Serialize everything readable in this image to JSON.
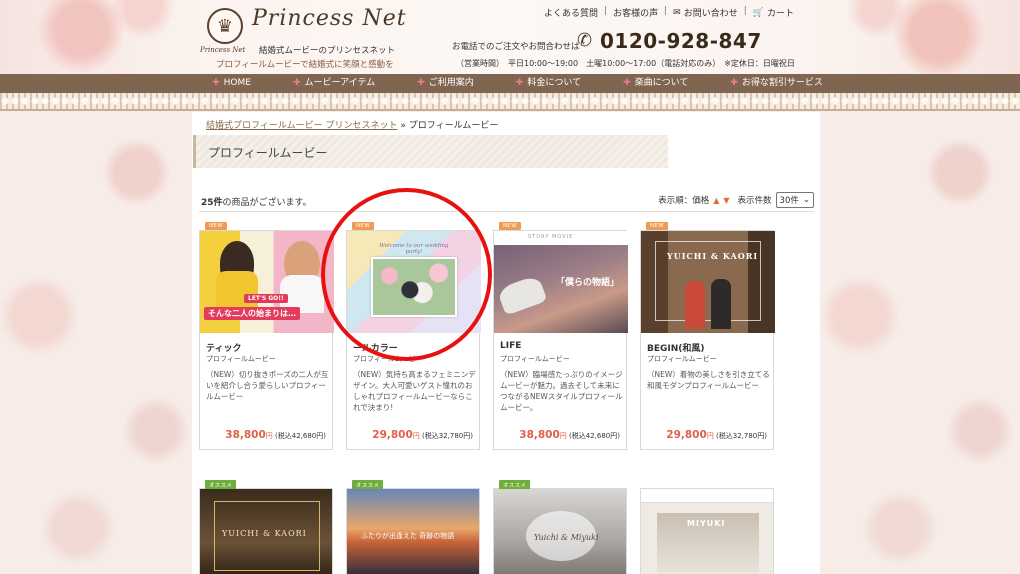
{
  "header": {
    "logo_script": "Princess Net",
    "logo_small": "Princess Net",
    "subtitle": "結婚式ムービーのプリンセスネット",
    "tagline": "プロフィールムービーで結婚式に笑顔と感動を",
    "top_links": [
      "よくある質問",
      "お客様の声",
      "お問い合わせ",
      "カート"
    ],
    "phone_lead": "お電話でのご注文やお問合わせは",
    "phone_number": "0120-928-847",
    "hours": "（営業時間）　平日10:00〜19:00　土曜10:00〜17:00（電話対応のみ）　※定休日：日曜祝日"
  },
  "nav": [
    "HOME",
    "ムービーアイテム",
    "ご利用案内",
    "料金について",
    "楽曲について",
    "お得な割引サービス"
  ],
  "breadcrumb": {
    "home": "結婚式プロフィールムービー プリンセスネット",
    "separator": "»",
    "current": "プロフィールムービー"
  },
  "page_title": "プロフィールムービー",
  "listing": {
    "count_number": "25件",
    "count_suffix": "の商品がございます。",
    "sort_label": "表示順：価格",
    "per_page_label": "表示件数",
    "per_page_value": "30件"
  },
  "products": [
    {
      "badge": "NEW",
      "title": "ティック",
      "category": "プロフィールムービー",
      "description": "（NEW）切り抜きポーズの二人が互いを紹介し合う愛らしいプロフィールムービー",
      "price": "38,800",
      "yen": "円",
      "tax": "(税込42,680円)",
      "thumb_text": "そんな二人の始まりは…",
      "thumb_badge": "LET'S GO!!"
    },
    {
      "badge": "NEW",
      "title": "ールカラー",
      "category": "プロフィールムービー",
      "description": "（NEW）気持ち高まるフェミニンデザイン。大人可愛いゲスト憧れのおしゃれプロフィールムービーならこれで決まり!",
      "price": "29,800",
      "yen": "円",
      "tax": "(税込32,780円)",
      "thumb_text": "Welcome to our wedding party!"
    },
    {
      "badge": "NEW",
      "title": "LIFE",
      "category": "プロフィールムービー",
      "description": "（NEW）臨場感たっぷりのイメージムービーが魅力。過去そして未来につながるNEWスタイルプロフィールムービー。",
      "price": "38,800",
      "yen": "円",
      "tax": "(税込42,680円)",
      "thumb_text": "「僕らの物語」",
      "thumb_top": "STORY MOVIE"
    },
    {
      "badge": "NEW",
      "title": "BEGIN(和風)",
      "category": "プロフィールムービー",
      "description": "（NEW）着物の美しさを引き立てる和風モダンプロフィールムービー",
      "price": "29,800",
      "yen": "円",
      "tax": "(税込32,780円)",
      "thumb_text": "YUICHI & KAORI"
    }
  ],
  "products_row2": [
    {
      "badge": "オススメ",
      "thumb_text": "YUICHI & KAORI"
    },
    {
      "badge": "オススメ",
      "thumb_text": "ふたりが出逢えた 奇跡の物語"
    },
    {
      "badge": "オススメ",
      "thumb_text": "Yuichi & Miyuki"
    },
    {
      "badge": "",
      "thumb_text": "MIYUKI"
    }
  ],
  "colors": {
    "nav_bg": "#806651",
    "price": "#e0604a",
    "badge_new": "#f09a52",
    "badge_recommend": "#6fae3c",
    "annotation_circle": "#e8110f"
  }
}
